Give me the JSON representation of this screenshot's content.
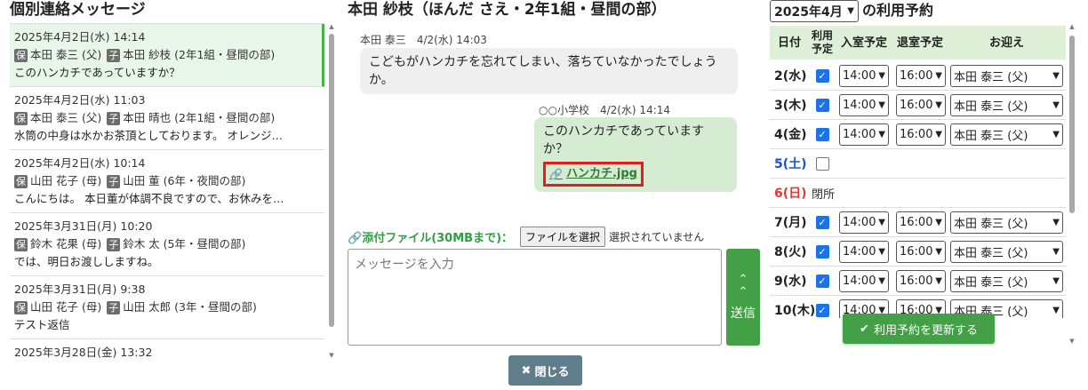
{
  "left": {
    "title": "個別連絡メッセージ",
    "messages": [
      {
        "date": "2025年4月2日(水) 14:14",
        "parent": "本田 泰三 (父)",
        "child": "本田 紗枝 (2年1組・昼間の部)",
        "preview": "このハンカチであっていますか？"
      },
      {
        "date": "2025年4月2日(水) 11:03",
        "parent": "本田 泰三 (父)",
        "child": "本田 晴也 (2年1組・昼間の部)",
        "preview": "水筒の中身は水かお茶頂としております。 オレンジ…"
      },
      {
        "date": "2025年4月2日(水) 10:14",
        "parent": "山田 花子 (母)",
        "child": "山田 董 (6年・夜間の部)",
        "preview": "こんにちは。 本日董が体調不良ですので、お休みを…"
      },
      {
        "date": "2025年3月31日(月) 10:20",
        "parent": "鈴木 花果 (母)",
        "child": "鈴木 太 (5年・昼間の部)",
        "preview": "では、明日お渡ししますね。"
      },
      {
        "date": "2025年3月31日(月) 9:38",
        "parent": "山田 花子 (母)",
        "child": "山田 太郎 (3年・昼間の部)",
        "preview": "テスト返信"
      },
      {
        "date": "2025年3月28日(金) 13:32",
        "parent": "",
        "child": "",
        "preview": ""
      }
    ],
    "parent_tag": "保",
    "child_tag": "子"
  },
  "middle": {
    "title": "本田 紗枝（ほんだ さえ・2年1組・昼間の部）",
    "incoming": {
      "meta": "本田 泰三　4/2(水) 14:03",
      "text": "こどもがハンカチを忘れてしまい、落ちていなかったでしょうか。"
    },
    "outgoing": {
      "meta": "○○小学校　4/2(水) 14:14",
      "text": "このハンカチであっていますか？",
      "attachment": "ハンカチ.jpg"
    },
    "attach_label": "添付ファイル(30MBまで)：",
    "file_button": "ファイルを選択",
    "file_status": "選択されていません",
    "input_placeholder": "メッセージを入力",
    "send_label": "送信",
    "close_label": "閉じる"
  },
  "right": {
    "month": "2025年4月",
    "title": "の利用予約",
    "headers": {
      "date": "日付",
      "use": "利用予定",
      "in": "入室予定",
      "out": "退室予定",
      "pickup": "お迎え"
    },
    "rows": [
      {
        "date": "2(水)",
        "checked": true,
        "in": "14:00",
        "out": "16:00",
        "pickup": "本田 泰三 (父)",
        "kind": "weekday"
      },
      {
        "date": "3(木)",
        "checked": true,
        "in": "14:00",
        "out": "16:00",
        "pickup": "本田 泰三 (父)",
        "kind": "weekday"
      },
      {
        "date": "4(金)",
        "checked": true,
        "in": "14:00",
        "out": "16:00",
        "pickup": "本田 泰三 (父)",
        "kind": "weekday"
      },
      {
        "date": "5(土)",
        "checked": false,
        "kind": "sat"
      },
      {
        "date": "6(日)",
        "kind": "sun",
        "note": "閉所"
      },
      {
        "date": "7(月)",
        "checked": true,
        "in": "14:00",
        "out": "16:00",
        "pickup": "本田 泰三 (父)",
        "kind": "weekday"
      },
      {
        "date": "8(火)",
        "checked": true,
        "in": "14:00",
        "out": "16:00",
        "pickup": "本田 泰三 (父)",
        "kind": "weekday"
      },
      {
        "date": "9(水)",
        "checked": true,
        "in": "14:00",
        "out": "16:00",
        "pickup": "本田 泰三 (父)",
        "kind": "weekday"
      },
      {
        "date": "10(木)",
        "checked": true,
        "in": "14:00",
        "out": "16:00",
        "pickup": "本田 泰三 (父)",
        "kind": "weekday"
      }
    ],
    "update_label": "利用予約を更新する"
  },
  "colors": {
    "accent_green": "#43a047",
    "header_green": "#dff0d8",
    "highlight_red": "#e02020",
    "saturday_blue": "#1a4fd0",
    "sunday_red": "#e53935"
  }
}
